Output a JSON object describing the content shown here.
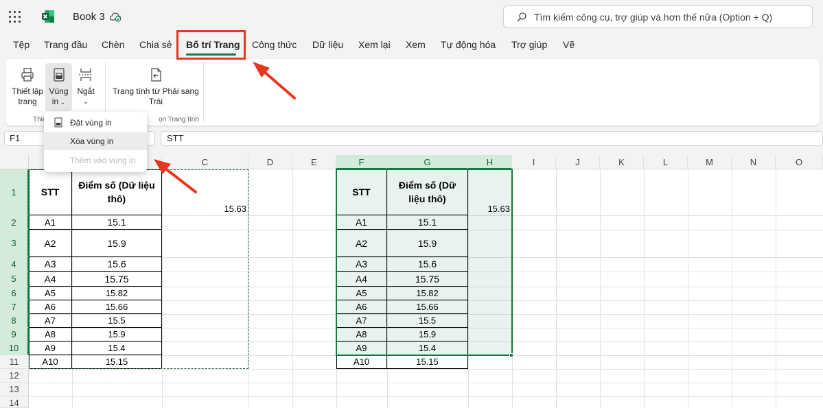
{
  "app": {
    "title": "Book 3",
    "search_placeholder": "Tìm kiếm công cụ, trợ giúp và hơn thế nữa (Option + Q)",
    "accent_color": "#107c41",
    "callout_color": "#e8351f"
  },
  "tabs": [
    {
      "label": "Tệp"
    },
    {
      "label": "Trang đầu"
    },
    {
      "label": "Chèn"
    },
    {
      "label": "Chia sẻ"
    },
    {
      "label": "Bố trí Trang",
      "active": true
    },
    {
      "label": "Công thức"
    },
    {
      "label": "Dữ liệu"
    },
    {
      "label": "Xem lại"
    },
    {
      "label": "Xem"
    },
    {
      "label": "Tự động hóa"
    },
    {
      "label": "Trợ giúp"
    },
    {
      "label": "Vẽ"
    }
  ],
  "ribbon": {
    "page_setup_line1": "Thiết lập",
    "page_setup_line2": "trang",
    "print_area_line1": "Vùng",
    "print_area_line2": "in",
    "breaks_label": "Ngắt",
    "rtl_line1": "Trang tính từ Phải sang",
    "rtl_line2": "Trái",
    "group1_label": "Thiế",
    "group2_label": "ọn Trang tính"
  },
  "dropdown": {
    "items": [
      {
        "label": "Đặt vùng in",
        "enabled": true
      },
      {
        "label": "Xóa vùng in",
        "enabled": true,
        "highlighted": true
      },
      {
        "label": "Thêm vào vùng in",
        "enabled": false
      }
    ]
  },
  "formula_bar": {
    "name_box": "F1",
    "formula": "STT"
  },
  "grid": {
    "columns": [
      "C",
      "D",
      "E",
      "F",
      "G",
      "H",
      "I",
      "J",
      "K",
      "L",
      "M",
      "N",
      "O"
    ],
    "rows": [
      "1",
      "2",
      "3",
      "4",
      "5",
      "6",
      "7",
      "8",
      "9",
      "10",
      "11",
      "12",
      "13",
      "14"
    ],
    "selected_columns": [
      "F",
      "G",
      "H"
    ],
    "selected_rows": [
      "1",
      "2",
      "3",
      "4",
      "5",
      "6",
      "7",
      "8",
      "9",
      "10"
    ]
  },
  "table_left": {
    "header_stt": "STT",
    "header_score": "Điểm số (Dữ liệu thô)",
    "extra_value": "15.63",
    "rows": [
      {
        "stt": "A1",
        "score": "15.1"
      },
      {
        "stt": "A2",
        "score": "15.9"
      },
      {
        "stt": "A3",
        "score": "15.6"
      },
      {
        "stt": "A4",
        "score": "15.75"
      },
      {
        "stt": "A5",
        "score": "15.82"
      },
      {
        "stt": "A6",
        "score": "15.66"
      },
      {
        "stt": "A7",
        "score": "15.5"
      },
      {
        "stt": "A8",
        "score": "15.9"
      },
      {
        "stt": "A9",
        "score": "15.4"
      },
      {
        "stt": "A10",
        "score": "15.15"
      }
    ]
  },
  "table_right": {
    "header_stt": "STT",
    "header_score": "Điểm số (Dữ liệu thô)",
    "extra_value": "15.63",
    "rows": [
      {
        "stt": "A1",
        "score": "15.1"
      },
      {
        "stt": "A2",
        "score": "15.9"
      },
      {
        "stt": "A3",
        "score": "15.6"
      },
      {
        "stt": "A4",
        "score": "15.75"
      },
      {
        "stt": "A5",
        "score": "15.82"
      },
      {
        "stt": "A6",
        "score": "15.66"
      },
      {
        "stt": "A7",
        "score": "15.5"
      },
      {
        "stt": "A8",
        "score": "15.9"
      },
      {
        "stt": "A9",
        "score": "15.4"
      },
      {
        "stt": "A10",
        "score": "15.15"
      }
    ]
  }
}
